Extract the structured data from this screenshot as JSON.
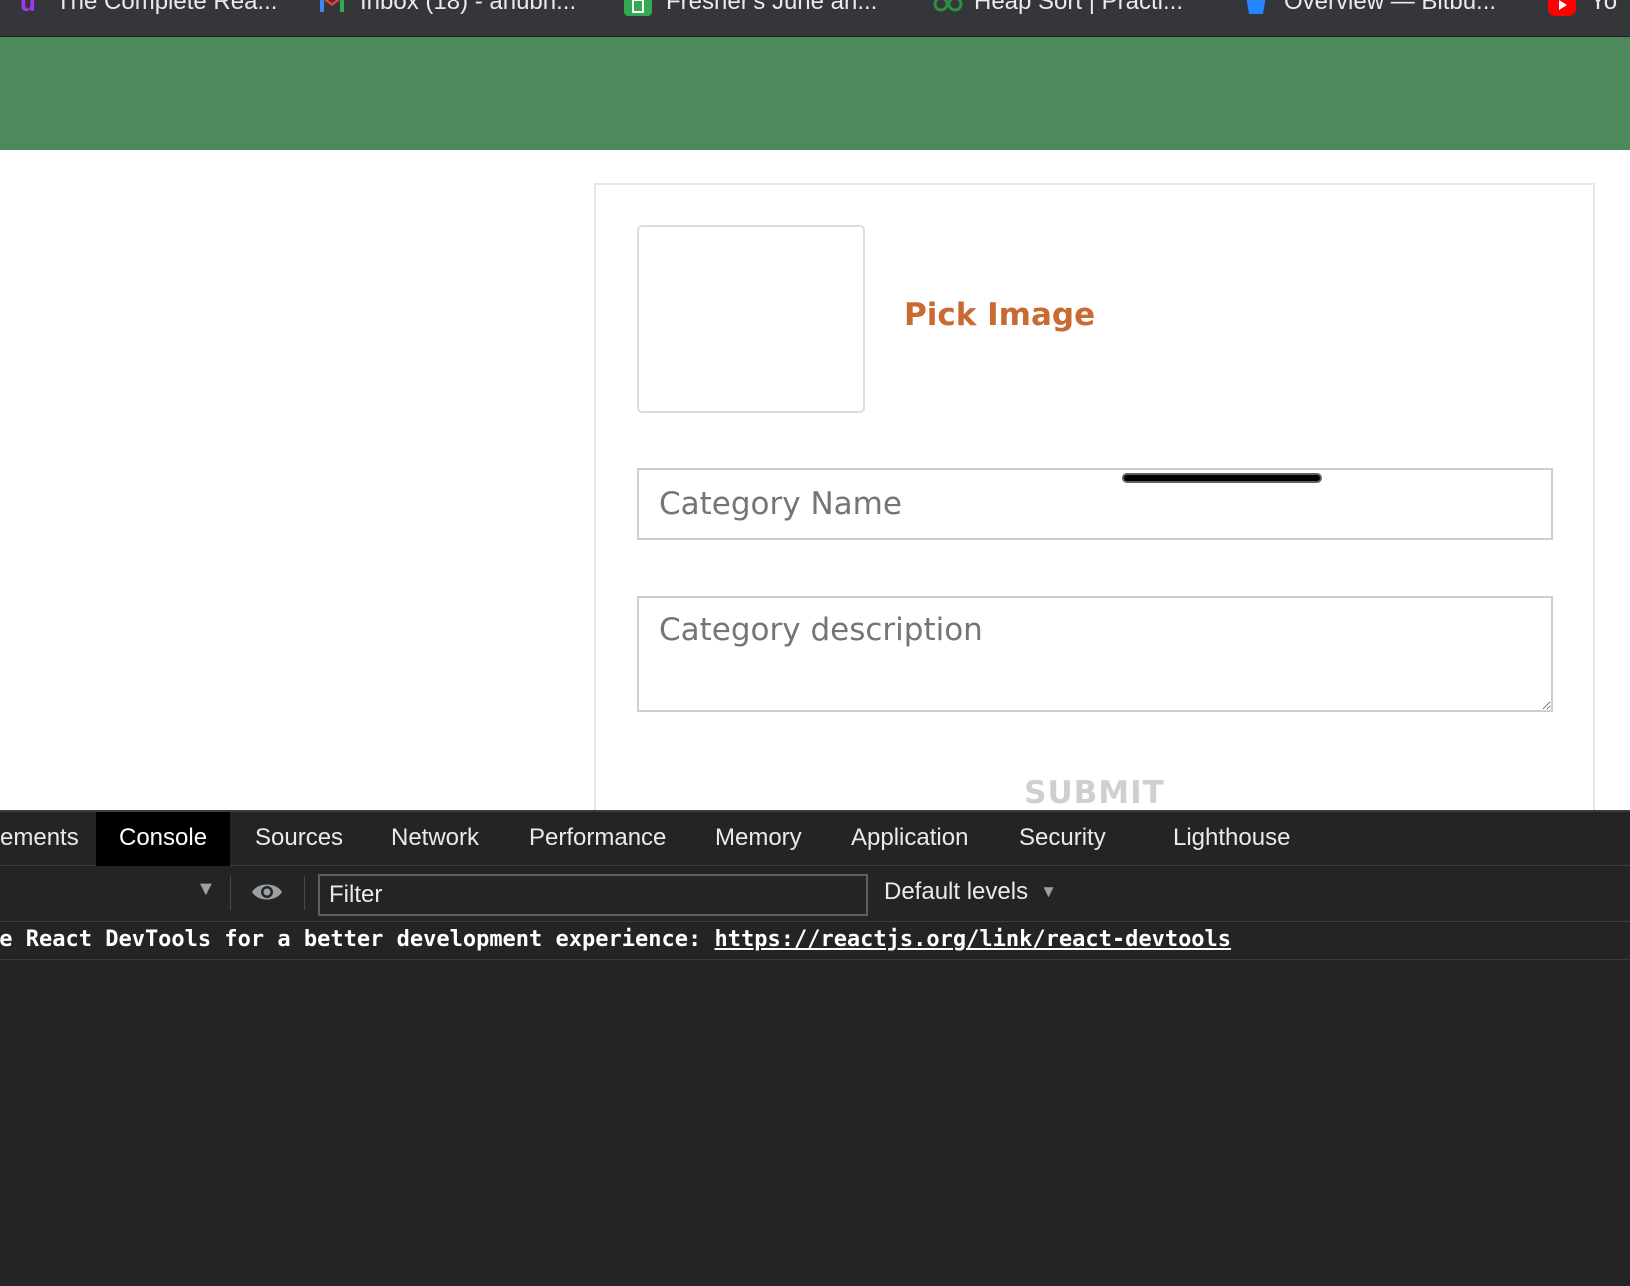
{
  "bookmarks": [
    {
      "label": "The Complete Rea...",
      "icon": "udemy-icon",
      "color": "#a435f0"
    },
    {
      "label": "Inbox (18) - anubh...",
      "icon": "gmail-icon",
      "color": "#ea4335"
    },
    {
      "label": "Fresher's June an...",
      "icon": "sheets-icon",
      "color": "#34a853"
    },
    {
      "label": "Heap Sort | Practi...",
      "icon": "geeksforgeeks-icon",
      "color": "#2f8d46"
    },
    {
      "label": "Overview — Bitbu...",
      "icon": "bitbucket-icon",
      "color": "#2684ff"
    },
    {
      "label": "Yo",
      "icon": "youtube-icon",
      "color": "#ff0000"
    }
  ],
  "app": {
    "header_color": "#4c8a5c",
    "pick_image_label": "Pick Image",
    "name_placeholder": "Category Name",
    "description_placeholder": "Category description",
    "submit_label": "SUBMIT",
    "accent_color": "#c96a33"
  },
  "devtools": {
    "tabs": [
      {
        "label": "ements",
        "active": false
      },
      {
        "label": "Console",
        "active": true
      },
      {
        "label": "Sources",
        "active": false
      },
      {
        "label": "Network",
        "active": false
      },
      {
        "label": "Performance",
        "active": false
      },
      {
        "label": "Memory",
        "active": false
      },
      {
        "label": "Application",
        "active": false
      },
      {
        "label": "Security",
        "active": false
      },
      {
        "label": "Lighthouse",
        "active": false
      }
    ],
    "filter_placeholder": "Filter",
    "levels_label": "Default levels",
    "message_text": "he React DevTools for a better development experience: ",
    "message_link": "https://reactjs.org/link/react-devtools"
  }
}
